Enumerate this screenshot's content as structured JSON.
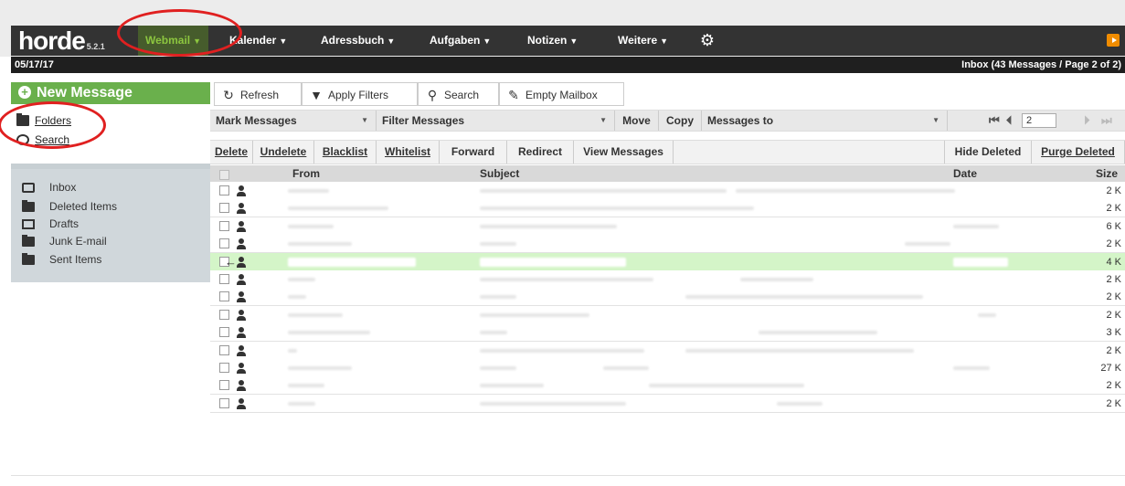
{
  "app": {
    "logo": "horde",
    "version": "5.2.1"
  },
  "nav": {
    "items": [
      {
        "label": "Webmail",
        "active": true
      },
      {
        "label": "Kalender"
      },
      {
        "label": "Adressbuch"
      },
      {
        "label": "Aufgaben"
      },
      {
        "label": "Notizen"
      },
      {
        "label": "Weitere"
      }
    ]
  },
  "status": {
    "date": "05/17/17",
    "mailbox_info": "Inbox (43 Messages / Page 2 of 2)"
  },
  "sidebar": {
    "new_message": "New Message",
    "links": [
      {
        "label": "Folders",
        "icon": "folder-icon"
      },
      {
        "label": "Search",
        "icon": "search-icon"
      }
    ],
    "folders": [
      {
        "label": "Inbox",
        "icon": "inbox-icon"
      },
      {
        "label": "Deleted Items",
        "icon": "folder-icon"
      },
      {
        "label": "Drafts",
        "icon": "drafts-icon"
      },
      {
        "label": "Junk E-mail",
        "icon": "folder-icon"
      },
      {
        "label": "Sent Items",
        "icon": "folder-icon"
      }
    ]
  },
  "toolbar": {
    "refresh": "Refresh",
    "apply_filters": "Apply Filters",
    "search": "Search",
    "empty_mailbox": "Empty Mailbox"
  },
  "actions": {
    "mark_messages": "Mark Messages",
    "filter_messages": "Filter Messages",
    "move": "Move",
    "copy": "Copy",
    "messages_to": "Messages to",
    "page": "2",
    "delete": "Delete",
    "undelete": "Undelete",
    "blacklist": "Blacklist",
    "whitelist": "Whitelist",
    "forward": "Forward",
    "redirect": "Redirect",
    "view_messages": "View Messages",
    "hide_deleted": "Hide Deleted",
    "purge_deleted": "Purge Deleted"
  },
  "table": {
    "columns": {
      "from": "From",
      "subject": "Subject",
      "date": "Date",
      "size": "Size"
    },
    "rows": [
      {
        "size": "2 K"
      },
      {
        "size": "2 K"
      },
      {
        "size": "6 K"
      },
      {
        "size": "2 K"
      },
      {
        "size": "4 K",
        "selected": true,
        "replied": true
      },
      {
        "size": "2 K"
      },
      {
        "size": "2 K"
      },
      {
        "size": "2 K"
      },
      {
        "size": "3 K"
      },
      {
        "size": "2 K"
      },
      {
        "size": "27 K"
      },
      {
        "size": "2 K"
      },
      {
        "size": "2 K"
      }
    ]
  },
  "colors": {
    "nav_bg": "#333333",
    "accent_green": "#6ab04c",
    "selected_row": "#d4f5c8",
    "annotation_red": "#e02020"
  }
}
